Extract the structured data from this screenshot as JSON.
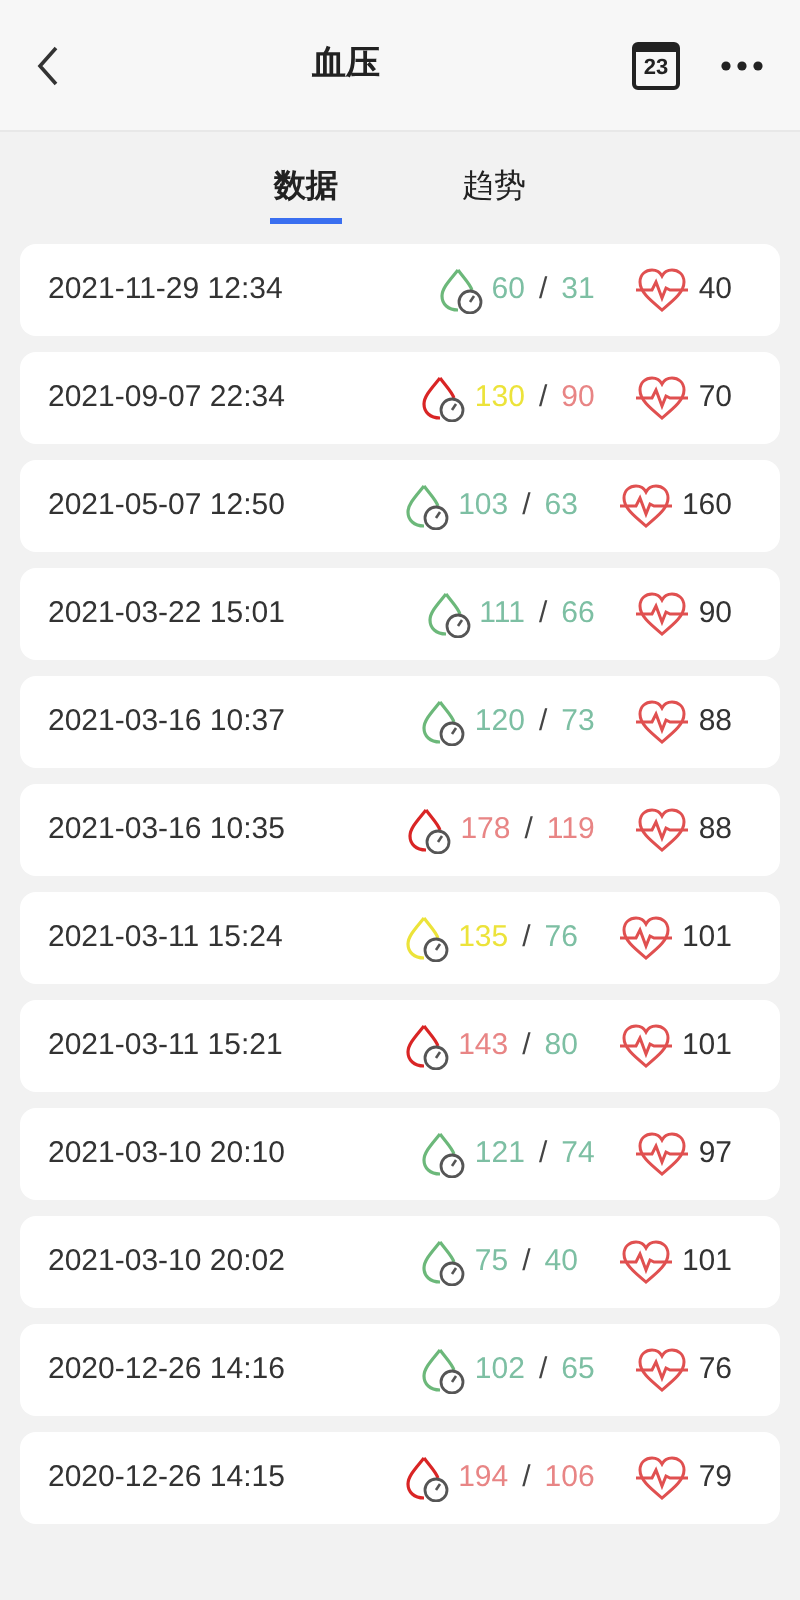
{
  "header": {
    "title": "血压",
    "calendar_day": "23"
  },
  "tabs": [
    {
      "label": "数据",
      "selected": true
    },
    {
      "label": "趋势",
      "selected": false
    }
  ],
  "records": [
    {
      "time": "2021-11-29 12:34",
      "drop": {
        "color": "#6cb87a"
      },
      "systolic": {
        "value": "60",
        "color": "#7dbfa3"
      },
      "diastolic": {
        "value": "31",
        "color": "#7dbfa3"
      },
      "separator": "/",
      "pulse": "40"
    },
    {
      "time": "2021-09-07 22:34",
      "drop": {
        "color": "#d92525"
      },
      "systolic": {
        "value": "130",
        "color": "#ece33a"
      },
      "diastolic": {
        "value": "90",
        "color": "#e88585"
      },
      "separator": "/",
      "pulse": "70"
    },
    {
      "time": "2021-05-07 12:50",
      "drop": {
        "color": "#6cb87a"
      },
      "systolic": {
        "value": "103",
        "color": "#7dbfa3"
      },
      "diastolic": {
        "value": "63",
        "color": "#7dbfa3"
      },
      "separator": "/",
      "pulse": "160"
    },
    {
      "time": "2021-03-22 15:01",
      "drop": {
        "color": "#6cb87a"
      },
      "systolic": {
        "value": "111",
        "color": "#7dbfa3"
      },
      "diastolic": {
        "value": "66",
        "color": "#7dbfa3"
      },
      "separator": "/",
      "pulse": "90"
    },
    {
      "time": "2021-03-16 10:37",
      "drop": {
        "color": "#6cb87a"
      },
      "systolic": {
        "value": "120",
        "color": "#7dbfa3"
      },
      "diastolic": {
        "value": "73",
        "color": "#7dbfa3"
      },
      "separator": "/",
      "pulse": "88"
    },
    {
      "time": "2021-03-16 10:35",
      "drop": {
        "color": "#d92525"
      },
      "systolic": {
        "value": "178",
        "color": "#e88585"
      },
      "diastolic": {
        "value": "119",
        "color": "#e88585"
      },
      "separator": "/",
      "pulse": "88"
    },
    {
      "time": "2021-03-11 15:24",
      "drop": {
        "color": "#ece33a"
      },
      "systolic": {
        "value": "135",
        "color": "#ece33a"
      },
      "diastolic": {
        "value": "76",
        "color": "#7dbfa3"
      },
      "separator": "/",
      "pulse": "101"
    },
    {
      "time": "2021-03-11 15:21",
      "drop": {
        "color": "#d92525"
      },
      "systolic": {
        "value": "143",
        "color": "#e88585"
      },
      "diastolic": {
        "value": "80",
        "color": "#7dbfa3"
      },
      "separator": "/",
      "pulse": "101"
    },
    {
      "time": "2021-03-10 20:10",
      "drop": {
        "color": "#6cb87a"
      },
      "systolic": {
        "value": "121",
        "color": "#7dbfa3"
      },
      "diastolic": {
        "value": "74",
        "color": "#7dbfa3"
      },
      "separator": "/",
      "pulse": "97"
    },
    {
      "time": "2021-03-10 20:02",
      "drop": {
        "color": "#6cb87a"
      },
      "systolic": {
        "value": "75",
        "color": "#7dbfa3"
      },
      "diastolic": {
        "value": "40",
        "color": "#7dbfa3"
      },
      "separator": "/",
      "pulse": "101"
    },
    {
      "time": "2020-12-26 14:16",
      "drop": {
        "color": "#6cb87a"
      },
      "systolic": {
        "value": "102",
        "color": "#7dbfa3"
      },
      "diastolic": {
        "value": "65",
        "color": "#7dbfa3"
      },
      "separator": "/",
      "pulse": "76"
    },
    {
      "time": "2020-12-26 14:15",
      "drop": {
        "color": "#d92525"
      },
      "systolic": {
        "value": "194",
        "color": "#e88585"
      },
      "diastolic": {
        "value": "106",
        "color": "#e88585"
      },
      "separator": "/",
      "pulse": "79"
    }
  ]
}
